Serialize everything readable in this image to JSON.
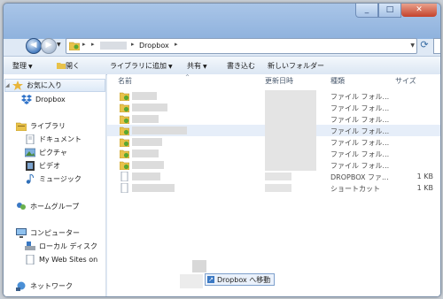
{
  "address_bar": {
    "current_folder": "Dropbox"
  },
  "toolbar": {
    "organize": "整理",
    "open": "開く",
    "add_to_library": "ライブラリに追加",
    "share": "共有",
    "burn": "書き込む",
    "new_folder": "新しいフォルダー"
  },
  "nav": {
    "favorites": "お気に入り",
    "dropbox": "Dropbox",
    "libraries": "ライブラリ",
    "documents": "ドキュメント",
    "pictures": "ピクチャ",
    "videos": "ビデオ",
    "music": "ミュージック",
    "homegroup": "ホームグループ",
    "computer": "コンピューター",
    "local_disk": "ローカル ディスク",
    "web_sites": "My Web Sites on",
    "network": "ネットワーク"
  },
  "columns": {
    "name": "名前",
    "modified": "更新日時",
    "type": "種類",
    "size": "サイズ"
  },
  "rows": [
    {
      "type": "ファイル フォル...",
      "size": ""
    },
    {
      "type": "ファイル フォル...",
      "size": ""
    },
    {
      "type": "ファイル フォル...",
      "size": ""
    },
    {
      "type": "ファイル フォル...",
      "size": ""
    },
    {
      "type": "ファイル フォル...",
      "size": ""
    },
    {
      "type": "ファイル フォル...",
      "size": ""
    },
    {
      "type": "ファイル フォル...",
      "size": ""
    },
    {
      "type": "DROPBOX ファ...",
      "size": "1 KB"
    },
    {
      "type": "ショートカット",
      "size": "1 KB"
    }
  ],
  "drag_tooltip": "Dropbox へ移動",
  "colors": {
    "folder_green": "#5aa832",
    "folder_yellow": "#e8c24a",
    "dropbox_blue": "#2f73c9",
    "selection": "#e6eef9"
  }
}
